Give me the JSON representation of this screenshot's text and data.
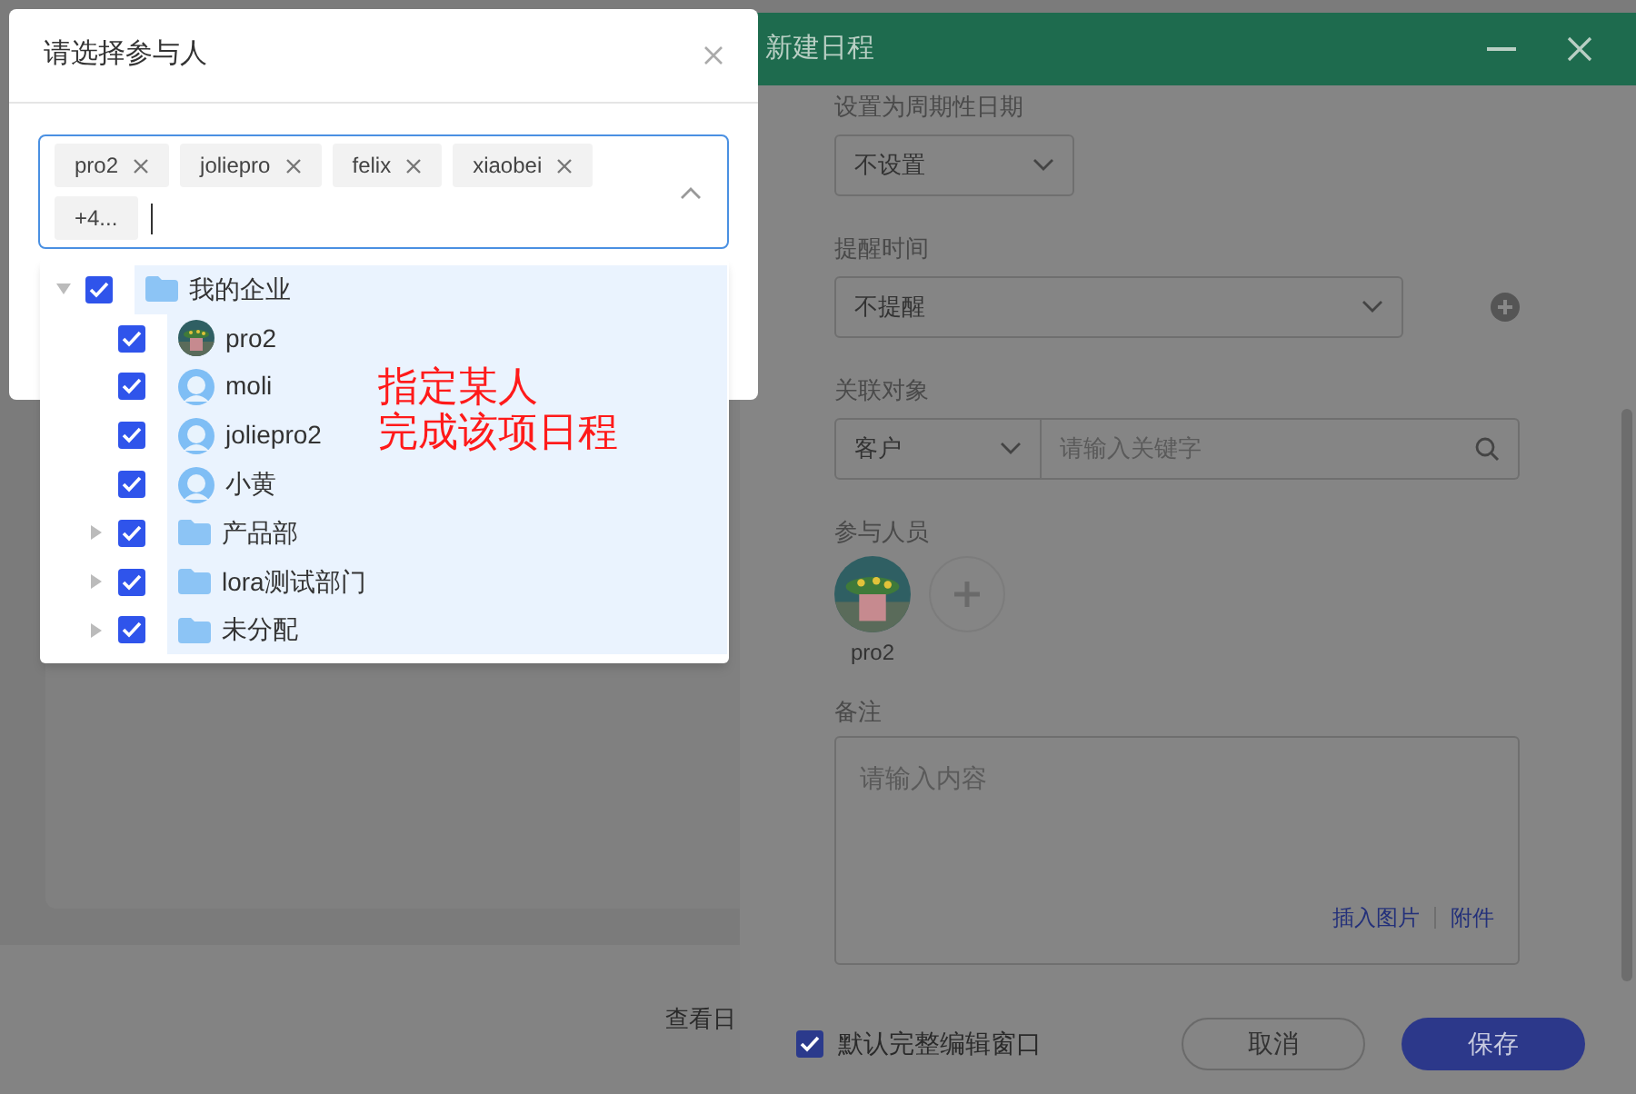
{
  "background": {
    "link_text": "查看日"
  },
  "schedule_panel": {
    "title": "新建日程",
    "fields": [
      {
        "kind": "select",
        "label": "设置为周期性日期",
        "value": "不设置"
      },
      {
        "kind": "select_add",
        "label": "提醒时间",
        "value": "不提醒"
      },
      {
        "kind": "relation",
        "label": "关联对象",
        "value": "客户",
        "placeholder": "请输入关键字"
      },
      {
        "kind": "participants",
        "label": "参与人员",
        "people": [
          {
            "name": "pro2"
          }
        ]
      },
      {
        "kind": "note",
        "label": "备注",
        "placeholder": "请输入内容",
        "links": [
          "插入图片",
          "附件"
        ]
      }
    ],
    "default_full_editor": {
      "label": "默认完整编辑窗口",
      "checked": true
    },
    "buttons": [
      {
        "label": "取消",
        "kind": "secondary"
      },
      {
        "label": "保存",
        "kind": "primary"
      }
    ]
  },
  "participant_dialog": {
    "title": "请选择参与人",
    "tags": [
      {
        "label": "pro2",
        "kind": "tag"
      },
      {
        "label": "joliepro",
        "kind": "tag"
      },
      {
        "label": "felix",
        "kind": "tag"
      },
      {
        "label": "xiaobei",
        "kind": "tag"
      },
      {
        "label": "+4...",
        "kind": "more"
      }
    ],
    "tree": [
      {
        "label": "我的企业",
        "kind": "folder",
        "checked": true,
        "expanded": true,
        "children": [
          {
            "label": "pro2",
            "kind": "photo_user",
            "checked": true
          },
          {
            "label": "moli",
            "kind": "user",
            "checked": true
          },
          {
            "label": "joliepro2",
            "kind": "user",
            "checked": true
          },
          {
            "label": "小黄",
            "kind": "user",
            "checked": true
          },
          {
            "label": "产品部",
            "kind": "folder",
            "checked": true,
            "expanded": false
          },
          {
            "label": "lora测试部门",
            "kind": "folder",
            "checked": true,
            "expanded": false
          },
          {
            "label": "未分配",
            "kind": "folder",
            "checked": true,
            "expanded": false
          }
        ]
      }
    ],
    "annotation": [
      "指定某人",
      "完成该项日程"
    ]
  }
}
